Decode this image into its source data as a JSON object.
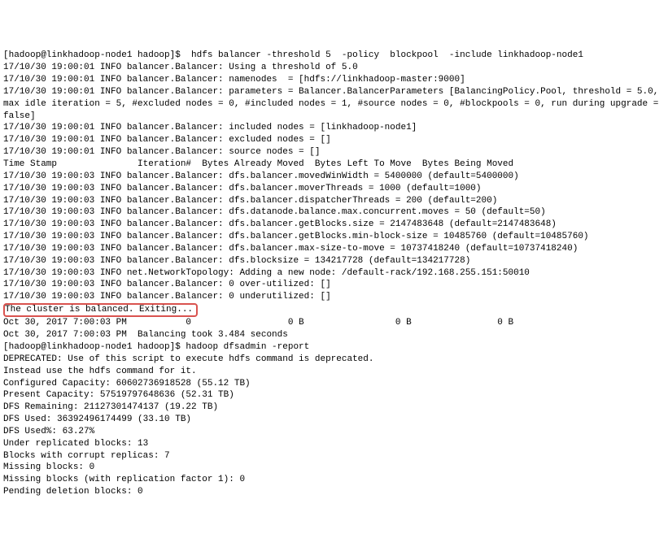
{
  "lines": [
    "[hadoop@linkhadoop-node1 hadoop]$  hdfs balancer -threshold 5  -policy  blockpool  -include linkhadoop-node1",
    "17/10/30 19:00:01 INFO balancer.Balancer: Using a threshold of 5.0",
    "17/10/30 19:00:01 INFO balancer.Balancer: namenodes  = [hdfs://linkhadoop-master:9000]",
    "17/10/30 19:00:01 INFO balancer.Balancer: parameters = Balancer.BalancerParameters [BalancingPolicy.Pool, threshold = 5.0, max idle iteration = 5, #excluded nodes = 0, #included nodes = 1, #source nodes = 0, #blockpools = 0, run during upgrade = false]",
    "17/10/30 19:00:01 INFO balancer.Balancer: included nodes = [linkhadoop-node1]",
    "17/10/30 19:00:01 INFO balancer.Balancer: excluded nodes = []",
    "17/10/30 19:00:01 INFO balancer.Balancer: source nodes = []",
    "Time Stamp               Iteration#  Bytes Already Moved  Bytes Left To Move  Bytes Being Moved",
    "17/10/30 19:00:03 INFO balancer.Balancer: dfs.balancer.movedWinWidth = 5400000 (default=5400000)",
    "17/10/30 19:00:03 INFO balancer.Balancer: dfs.balancer.moverThreads = 1000 (default=1000)",
    "17/10/30 19:00:03 INFO balancer.Balancer: dfs.balancer.dispatcherThreads = 200 (default=200)",
    "17/10/30 19:00:03 INFO balancer.Balancer: dfs.datanode.balance.max.concurrent.moves = 50 (default=50)",
    "17/10/30 19:00:03 INFO balancer.Balancer: dfs.balancer.getBlocks.size = 2147483648 (default=2147483648)",
    "17/10/30 19:00:03 INFO balancer.Balancer: dfs.balancer.getBlocks.min-block-size = 10485760 (default=10485760)",
    "17/10/30 19:00:03 INFO balancer.Balancer: dfs.balancer.max-size-to-move = 10737418240 (default=10737418240)",
    "17/10/30 19:00:03 INFO balancer.Balancer: dfs.blocksize = 134217728 (default=134217728)",
    "17/10/30 19:00:03 INFO net.NetworkTopology: Adding a new node: /default-rack/192.168.255.151:50010",
    "17/10/30 19:00:03 INFO balancer.Balancer: 0 over-utilized: []",
    "17/10/30 19:00:03 INFO balancer.Balancer: 0 underutilized: []"
  ],
  "highlighted_line": "The cluster is balanced. Exiting...",
  "lines_after": [
    "Oct 30, 2017 7:00:03 PM           0                  0 B                 0 B                0 B",
    "Oct 30, 2017 7:00:03 PM  Balancing took 3.484 seconds",
    "[hadoop@linkhadoop-node1 hadoop]$ hadoop dfsadmin -report",
    "DEPRECATED: Use of this script to execute hdfs command is deprecated.",
    "Instead use the hdfs command for it.",
    "",
    "Configured Capacity: 60602736918528 (55.12 TB)",
    "Present Capacity: 57519797648636 (52.31 TB)",
    "DFS Remaining: 21127301474137 (19.22 TB)",
    "DFS Used: 36392496174499 (33.10 TB)",
    "DFS Used%: 63.27%",
    "Under replicated blocks: 13",
    "Blocks with corrupt replicas: 7",
    "Missing blocks: 0",
    "Missing blocks (with replication factor 1): 0",
    "Pending deletion blocks: 0"
  ]
}
